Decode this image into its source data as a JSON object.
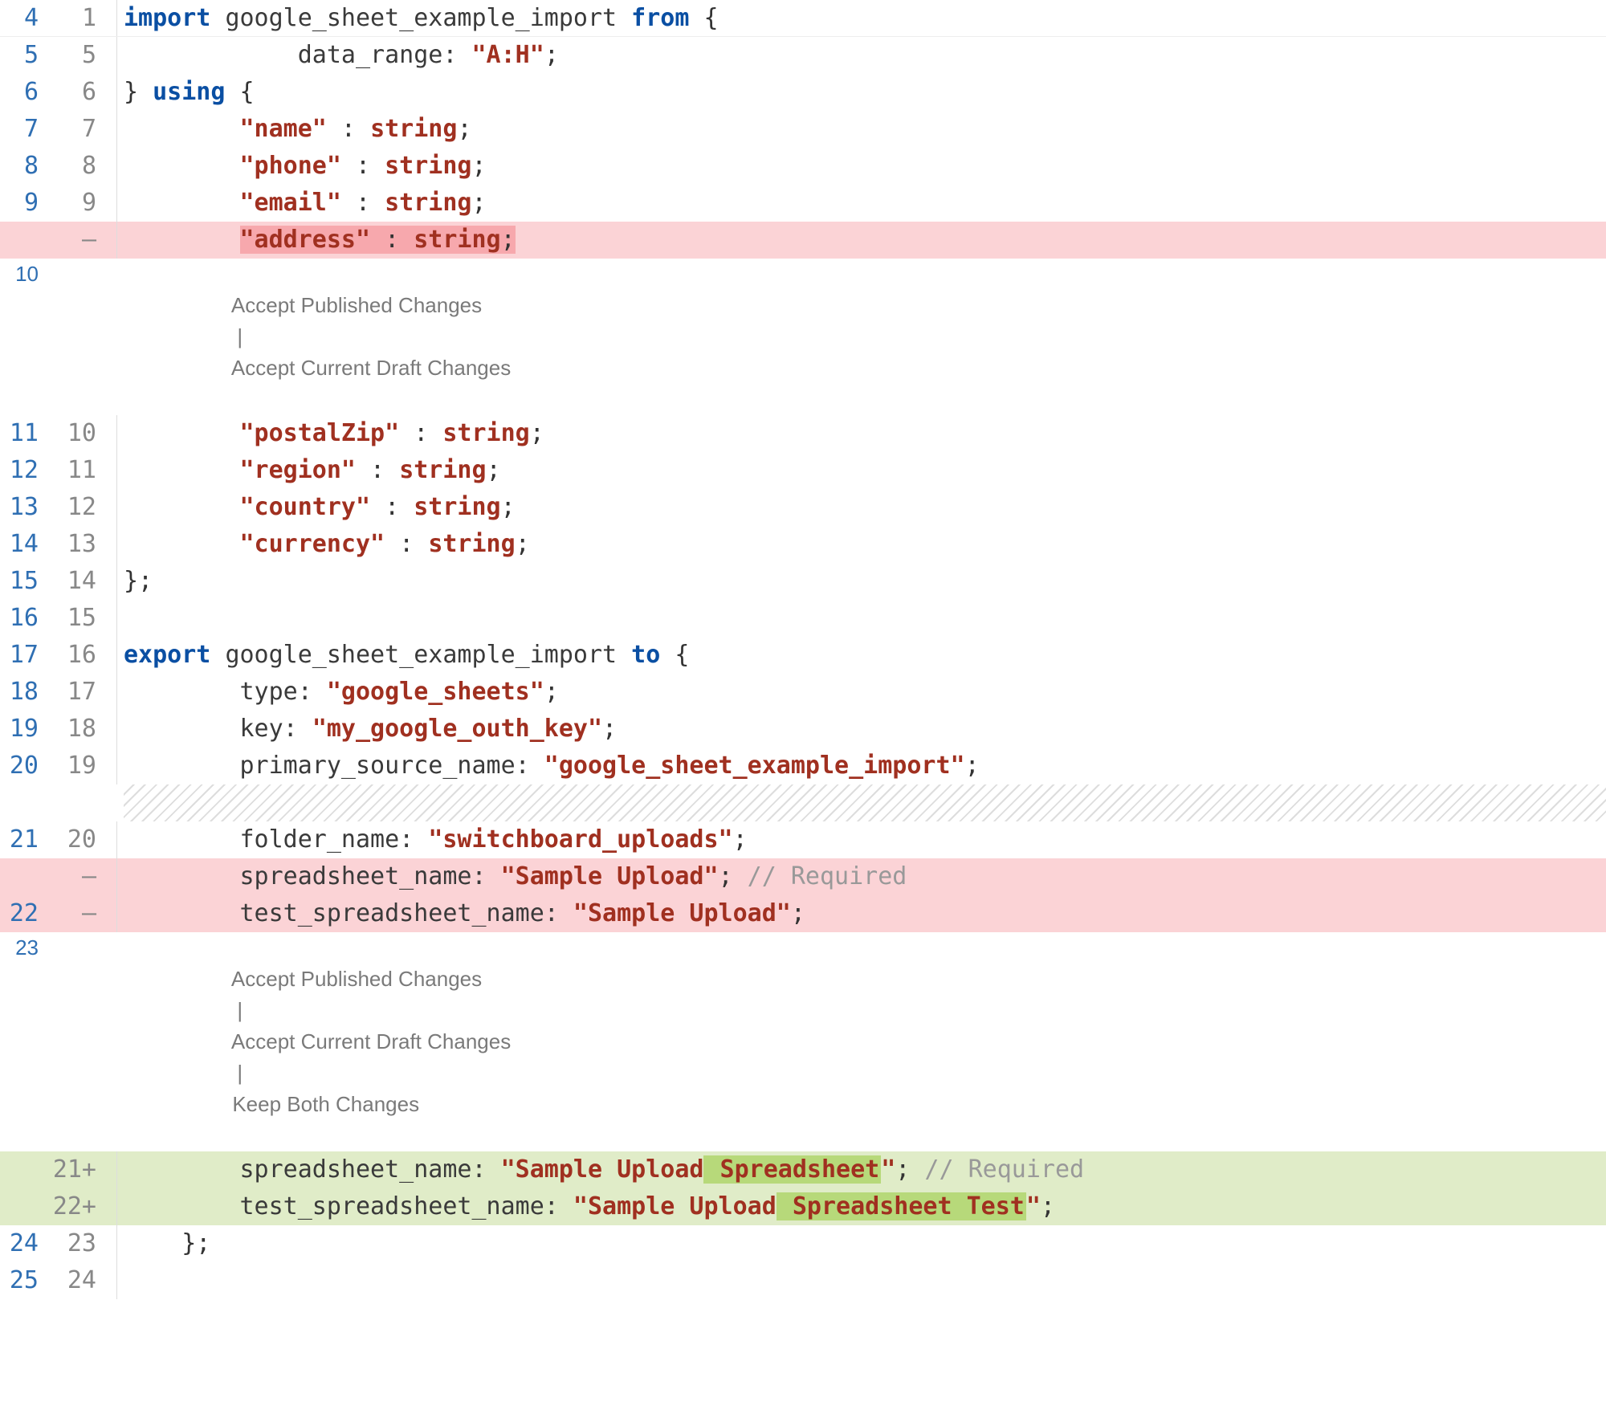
{
  "gutter": {
    "r1": {
      "a": "4",
      "b": "1"
    },
    "r2": {
      "a": "5",
      "b": "5"
    },
    "r3": {
      "a": "6",
      "b": "6"
    },
    "r4": {
      "a": "7",
      "b": "7"
    },
    "r5": {
      "a": "8",
      "b": "8"
    },
    "r6": {
      "a": "9",
      "b": "9"
    },
    "r7": {
      "a": "",
      "b": ""
    },
    "r8": {
      "a": "10",
      "b": ""
    },
    "r9": {
      "a": "11",
      "b": "10"
    },
    "r10": {
      "a": "12",
      "b": "11"
    },
    "r11": {
      "a": "13",
      "b": "12"
    },
    "r12": {
      "a": "14",
      "b": "13"
    },
    "r13": {
      "a": "15",
      "b": "14"
    },
    "r14": {
      "a": "16",
      "b": "15"
    },
    "r15": {
      "a": "17",
      "b": "16"
    },
    "r16": {
      "a": "18",
      "b": "17"
    },
    "r17": {
      "a": "19",
      "b": "18"
    },
    "r18": {
      "a": "20",
      "b": "19"
    },
    "r19": {
      "a": "21",
      "b": "20"
    },
    "r20": {
      "a": "",
      "b": ""
    },
    "r21": {
      "a": "22",
      "b": ""
    },
    "r22": {
      "a": "23",
      "b": ""
    },
    "r23": {
      "a": "",
      "b": "21+"
    },
    "r24": {
      "a": "",
      "b": "22+"
    },
    "r25": {
      "a": "24",
      "b": "23"
    },
    "r26": {
      "a": "25",
      "b": "24"
    }
  },
  "tokens": {
    "import": "import",
    "from": "from",
    "using": "using",
    "export": "export",
    "to": "to",
    "google_sheet_example_import": "google_sheet_example_import",
    "data_range": "data_range:",
    "data_range_val": "\"A:H\"",
    "name": "\"name\"",
    "phone": "\"phone\"",
    "email": "\"email\"",
    "address": "\"address\"",
    "postalZip": "\"postalZip\"",
    "region": "\"region\"",
    "country": "\"country\"",
    "currency": "\"currency\"",
    "string": "string",
    "type_lbl": "type:",
    "type_val": "\"google_sheets\"",
    "key_lbl": "key:",
    "key_val": "\"my_google_outh_key\"",
    "psn_lbl": "primary_source_name:",
    "psn_val": "\"google_sheet_example_import\"",
    "folder_lbl": "folder_name:",
    "folder_val": "\"switchboard_uploads\"",
    "ssn_lbl": "spreadsheet_name:",
    "ssn_val_old": "\"Sample Upload\"",
    "tssn_lbl": "test_spreadsheet_name:",
    "tssn_val_old": "\"Sample Upload\"",
    "ssn_val_new_pre": "\"Sample Upload",
    "ssn_val_new_hl": " Spreadsheet",
    "ssn_val_new_post": "\"",
    "tssn_val_new_pre": "\"Sample Upload",
    "tssn_val_new_hl": " Spreadsheet Test",
    "tssn_val_new_post": "\"",
    "required": "// Required",
    "colon": " : ",
    "semi": ";",
    "lbrace": "{",
    "rbrace": "}",
    "rbrace_semi": "};",
    "rbrace_using": "} "
  },
  "actions": {
    "first": {
      "publish": "Accept Published Changes",
      "draft": "Accept Current Draft Changes"
    },
    "second": {
      "publish": "Accept Published Changes",
      "draft": "Accept Current Draft Changes",
      "both": "Keep Both Changes"
    },
    "sep": "|"
  },
  "dash": "—"
}
